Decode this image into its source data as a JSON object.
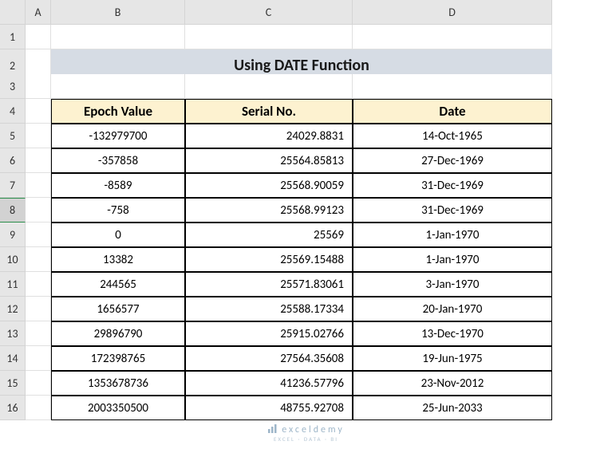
{
  "columns": [
    "",
    "A",
    "B",
    "C",
    "D"
  ],
  "rownums": [
    "1",
    "2",
    "3",
    "4",
    "5",
    "6",
    "7",
    "8",
    "9",
    "10",
    "11",
    "12",
    "13",
    "14",
    "15",
    "16"
  ],
  "selected_row": "8",
  "title": "Using DATE Function",
  "headers": {
    "b": "Epoch Value",
    "c": "Serial No.",
    "d": "Date"
  },
  "rows": [
    {
      "b": "-132979700",
      "c": "24029.8831",
      "d": "14-Oct-1965"
    },
    {
      "b": "-357858",
      "c": "25564.85813",
      "d": "27-Dec-1969"
    },
    {
      "b": "-8589",
      "c": "25568.90059",
      "d": "31-Dec-1969"
    },
    {
      "b": "-758",
      "c": "25568.99123",
      "d": "31-Dec-1969"
    },
    {
      "b": "0",
      "c": "25569",
      "d": "1-Jan-1970"
    },
    {
      "b": "13382",
      "c": "25569.15488",
      "d": "1-Jan-1970"
    },
    {
      "b": "244565",
      "c": "25571.83061",
      "d": "3-Jan-1970"
    },
    {
      "b": "1656577",
      "c": "25588.17334",
      "d": "20-Jan-1970"
    },
    {
      "b": "29896790",
      "c": "25915.02766",
      "d": "13-Dec-1970"
    },
    {
      "b": "172398765",
      "c": "27564.35608",
      "d": "19-Jun-1975"
    },
    {
      "b": "1353678736",
      "c": "41236.57796",
      "d": "23-Nov-2012"
    },
    {
      "b": "2003350500",
      "c": "48755.92708",
      "d": "25-Jun-2033"
    }
  ],
  "watermark": {
    "brand": "exceldemy",
    "tag": "EXCEL · DATA · BI"
  },
  "chart_data": {
    "type": "table",
    "title": "Using DATE Function",
    "columns": [
      "Epoch Value",
      "Serial No.",
      "Date"
    ],
    "rows": [
      [
        -132979700,
        24029.8831,
        "14-Oct-1965"
      ],
      [
        -357858,
        25564.85813,
        "27-Dec-1969"
      ],
      [
        -8589,
        25568.90059,
        "31-Dec-1969"
      ],
      [
        -758,
        25568.99123,
        "31-Dec-1969"
      ],
      [
        0,
        25569,
        "1-Jan-1970"
      ],
      [
        13382,
        25569.15488,
        "1-Jan-1970"
      ],
      [
        244565,
        25571.83061,
        "3-Jan-1970"
      ],
      [
        1656577,
        25588.17334,
        "20-Jan-1970"
      ],
      [
        29896790,
        25915.02766,
        "13-Dec-1970"
      ],
      [
        172398765,
        27564.35608,
        "19-Jun-1975"
      ],
      [
        1353678736,
        41236.57796,
        "23-Nov-2012"
      ],
      [
        2003350500,
        48755.92708,
        "25-Jun-2033"
      ]
    ]
  }
}
